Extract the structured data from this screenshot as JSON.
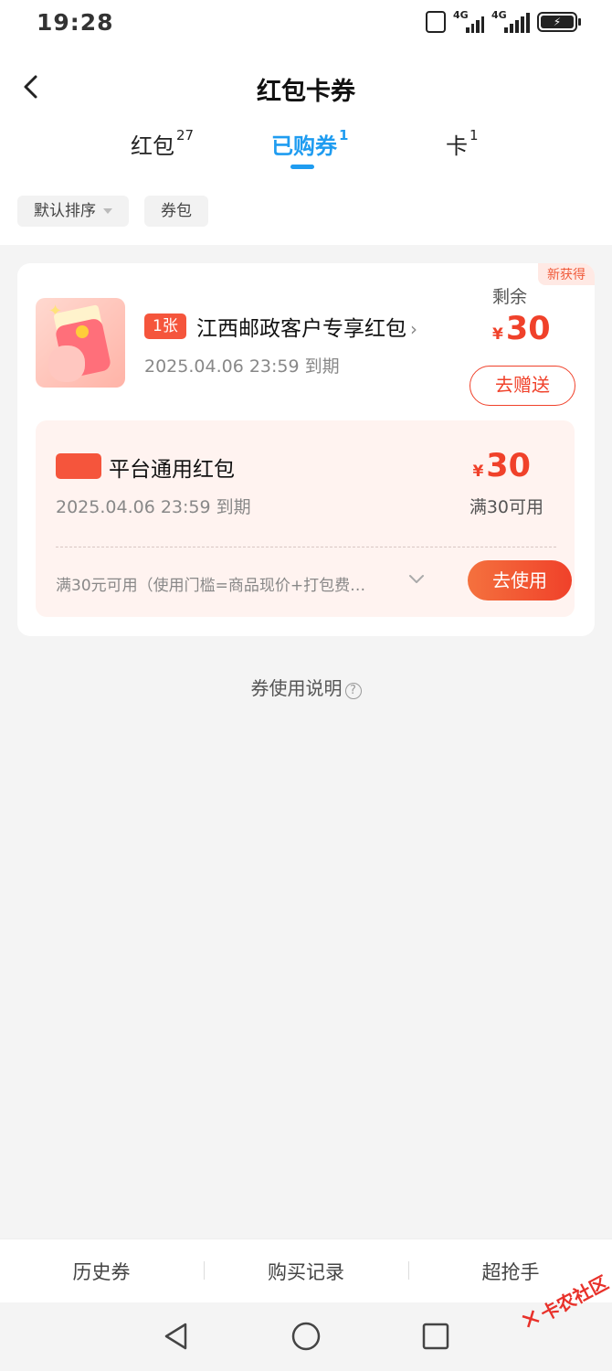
{
  "status_bar": {
    "time": "19:28",
    "net1": "4G",
    "net2": "4G"
  },
  "header": {
    "title": "红包卡券",
    "tabs": [
      {
        "label": "红包",
        "count": "27"
      },
      {
        "label": "已购券",
        "count": "1"
      },
      {
        "label": "卡",
        "count": "1"
      }
    ],
    "active_tab": "已购券",
    "filters": {
      "sort": "默认排序",
      "wallet": "券包"
    }
  },
  "coupon": {
    "badge": "新获得",
    "count_tag": "1张",
    "name": "江西邮政客户专享红包",
    "expire": "2025.04.06 23:59 到期",
    "remain_label": "剩余",
    "currency": "¥",
    "remain_amount": "30",
    "gift_button": "去赠送",
    "detail": {
      "name": "平台通用红包",
      "expire": "2025.04.06 23:59 到期",
      "currency": "¥",
      "amount": "30",
      "condition": "满30可用",
      "rule": "满30元可用（使用门槛=商品现价+打包费…",
      "use_button": "去使用"
    }
  },
  "instructions": {
    "label": "券使用说明",
    "help_icon": "?"
  },
  "bottom_bar": {
    "items": [
      "历史券",
      "购买记录",
      "超抢手"
    ]
  },
  "watermark": {
    "text": "卡农社区"
  },
  "colors": {
    "accent": "#1f9cf0",
    "red": "#f0412a"
  }
}
